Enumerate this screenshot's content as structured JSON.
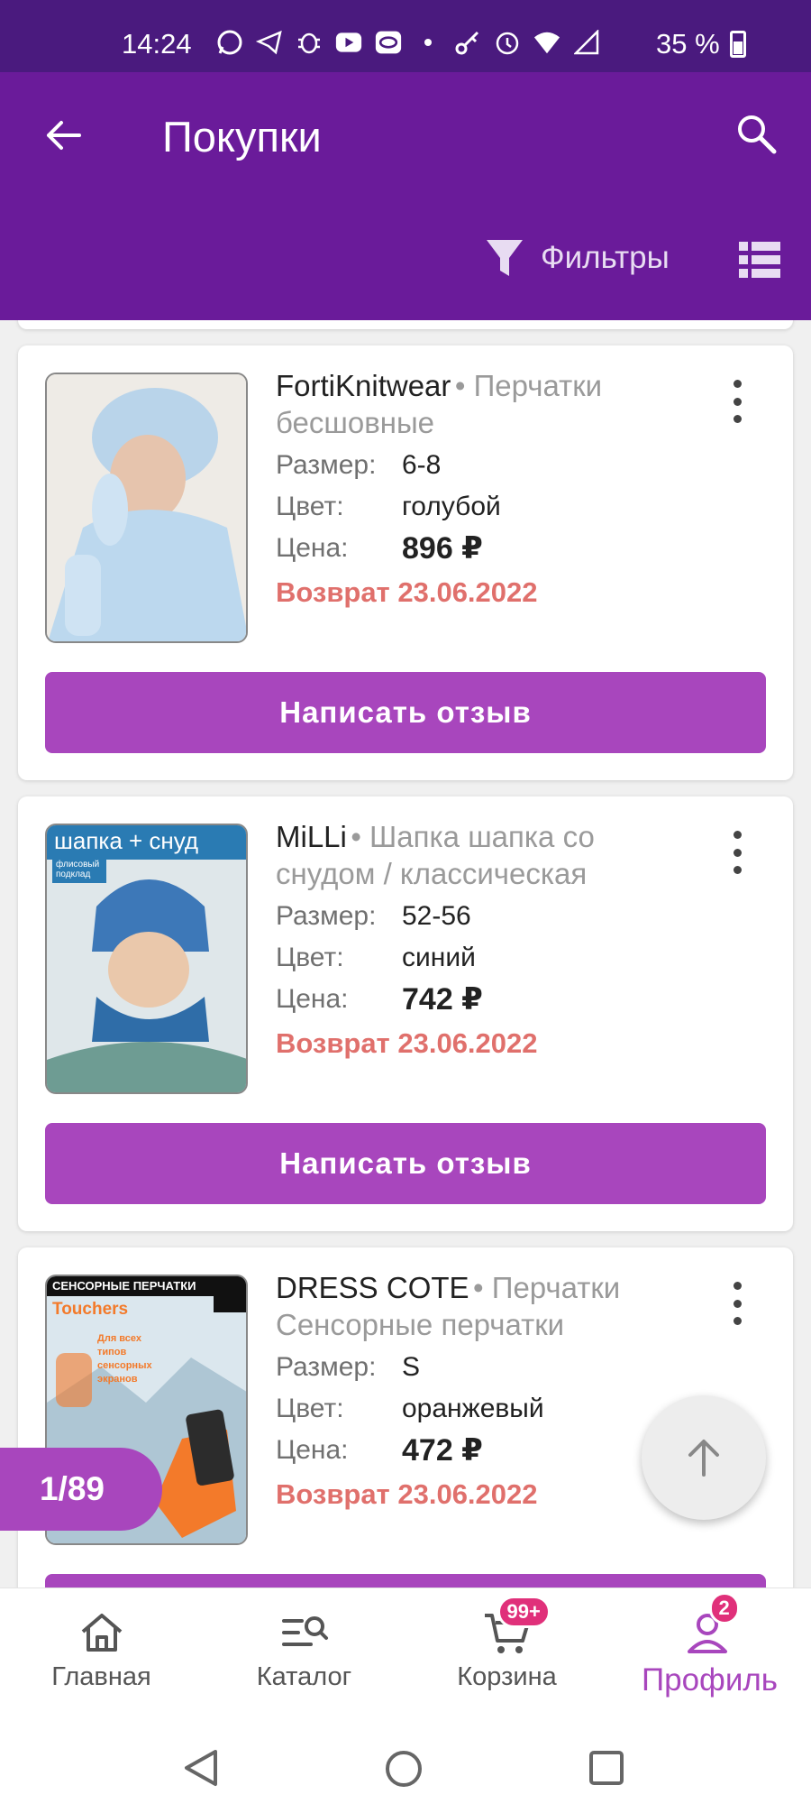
{
  "status_bar": {
    "time": "14:24",
    "battery": "35 %",
    "icons": [
      "whatsapp-icon",
      "telegram-icon",
      "bug-icon",
      "youtube-icon",
      "app-icon",
      "dot-icon",
      "key-icon",
      "alarm-icon",
      "wifi-icon",
      "signal-icon",
      "battery-icon"
    ]
  },
  "appbar": {
    "title": "Покупки",
    "filters_label": "Фильтры"
  },
  "colors": {
    "appbar": "#6a1b9a",
    "statusbar": "#4a1a7e",
    "accent": "#a846bd",
    "return_text": "#e0706c",
    "badge": "#e0307a"
  },
  "labels": {
    "size": "Размер:",
    "color": "Цвет:",
    "price": "Цена:"
  },
  "products": [
    {
      "brand": "FortiKnitwear",
      "name": "Перчатки бесшовные",
      "size": "6-8",
      "color": "голубой",
      "price": "896 ₽",
      "return": "Возврат 23.06.2022",
      "button": "Написать отзыв"
    },
    {
      "brand": "MiLLi",
      "name": "Шапка шапка со снудом / классическая",
      "size": "52-56",
      "color": "синий",
      "price": "742 ₽",
      "return": "Возврат 23.06.2022",
      "button": "Написать отзыв",
      "image_text": "шапка + снуд",
      "image_subtext": "флисовый подклад"
    },
    {
      "brand": "DRESS COTE",
      "name": "Перчатки Сенсорные перчатки",
      "size": "S",
      "color": "оранжевый",
      "price": "472 ₽",
      "return": "Возврат 23.06.2022",
      "image_text": "СЕНСОРНЫЕ ПЕРЧАТКИ",
      "image_subtext": "Touchers",
      "image_note": "Для всех типов сенсорных экранов"
    }
  ],
  "pager": "1/89",
  "bottom_nav": [
    {
      "label": "Главная",
      "icon": "home-icon"
    },
    {
      "label": "Каталог",
      "icon": "catalog-search-icon"
    },
    {
      "label": "Корзина",
      "icon": "cart-icon",
      "badge": "99+"
    },
    {
      "label": "Профиль",
      "icon": "profile-icon",
      "badge": "2",
      "active": true
    }
  ]
}
